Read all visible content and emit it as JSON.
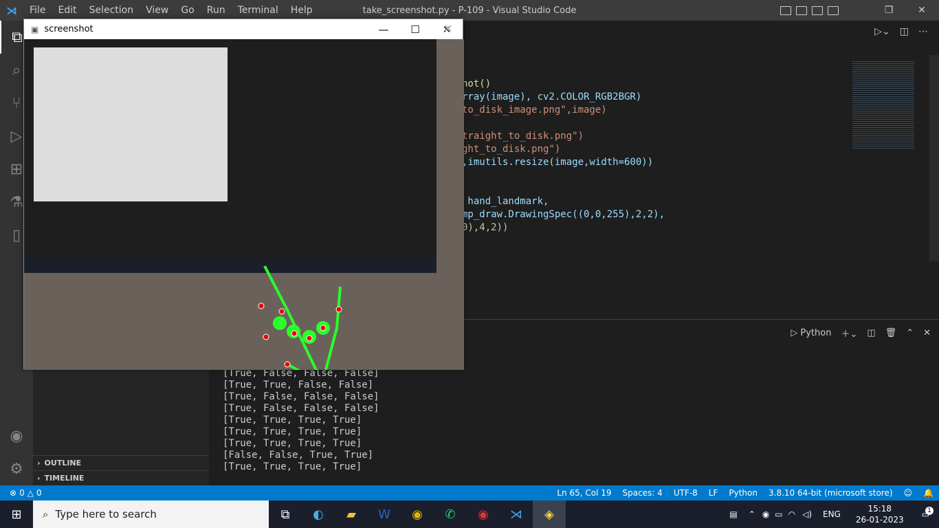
{
  "app": {
    "title": "take_screenshot.py - P-109 - Visual Studio Code",
    "menu": [
      "File",
      "Edit",
      "Selection",
      "View",
      "Go",
      "Run",
      "Terminal",
      "Help"
    ]
  },
  "editor": {
    "code_lines": [
      "hot()",
      "rray(image), cv2.COLOR_RGB2BGR)",
      "to_disk_image.png\",image)",
      "",
      "traight_to_disk.png\")",
      "ght_to_disk.png\")",
      ",imutils.resize(image,width=600))",
      "",
      " hand_landmark,",
      "mp_draw.DrawingSpec((0,0,255),2,2),",
      "0),4,2))"
    ]
  },
  "panel": {
    "terminal_label": "Python",
    "output_lines": [
      "[True, False, False, False]",
      "[True, True, False, False]",
      "[True, False, False, False]",
      "[True, False, False, False]",
      "[True, True, True, True]",
      "[True, True, True, True]",
      "[True, True, True, True]",
      "[False, False, True, True]",
      "[True, True, True, True]"
    ]
  },
  "sidebar": {
    "outline": "OUTLINE",
    "timeline": "TIMELINE"
  },
  "status": {
    "errors": "0",
    "warnings": "0",
    "position": "Ln 65, Col 19",
    "spaces": "Spaces: 4",
    "encoding": "UTF-8",
    "eol": "LF",
    "language": "Python",
    "interpreter": "3.8.10 64-bit (microsoft store)"
  },
  "popup": {
    "title": "screenshot"
  },
  "taskbar": {
    "search_placeholder": "Type here to search",
    "language": "ENG",
    "time": "15:18",
    "date": "26-01-2023",
    "notifications": "1"
  }
}
